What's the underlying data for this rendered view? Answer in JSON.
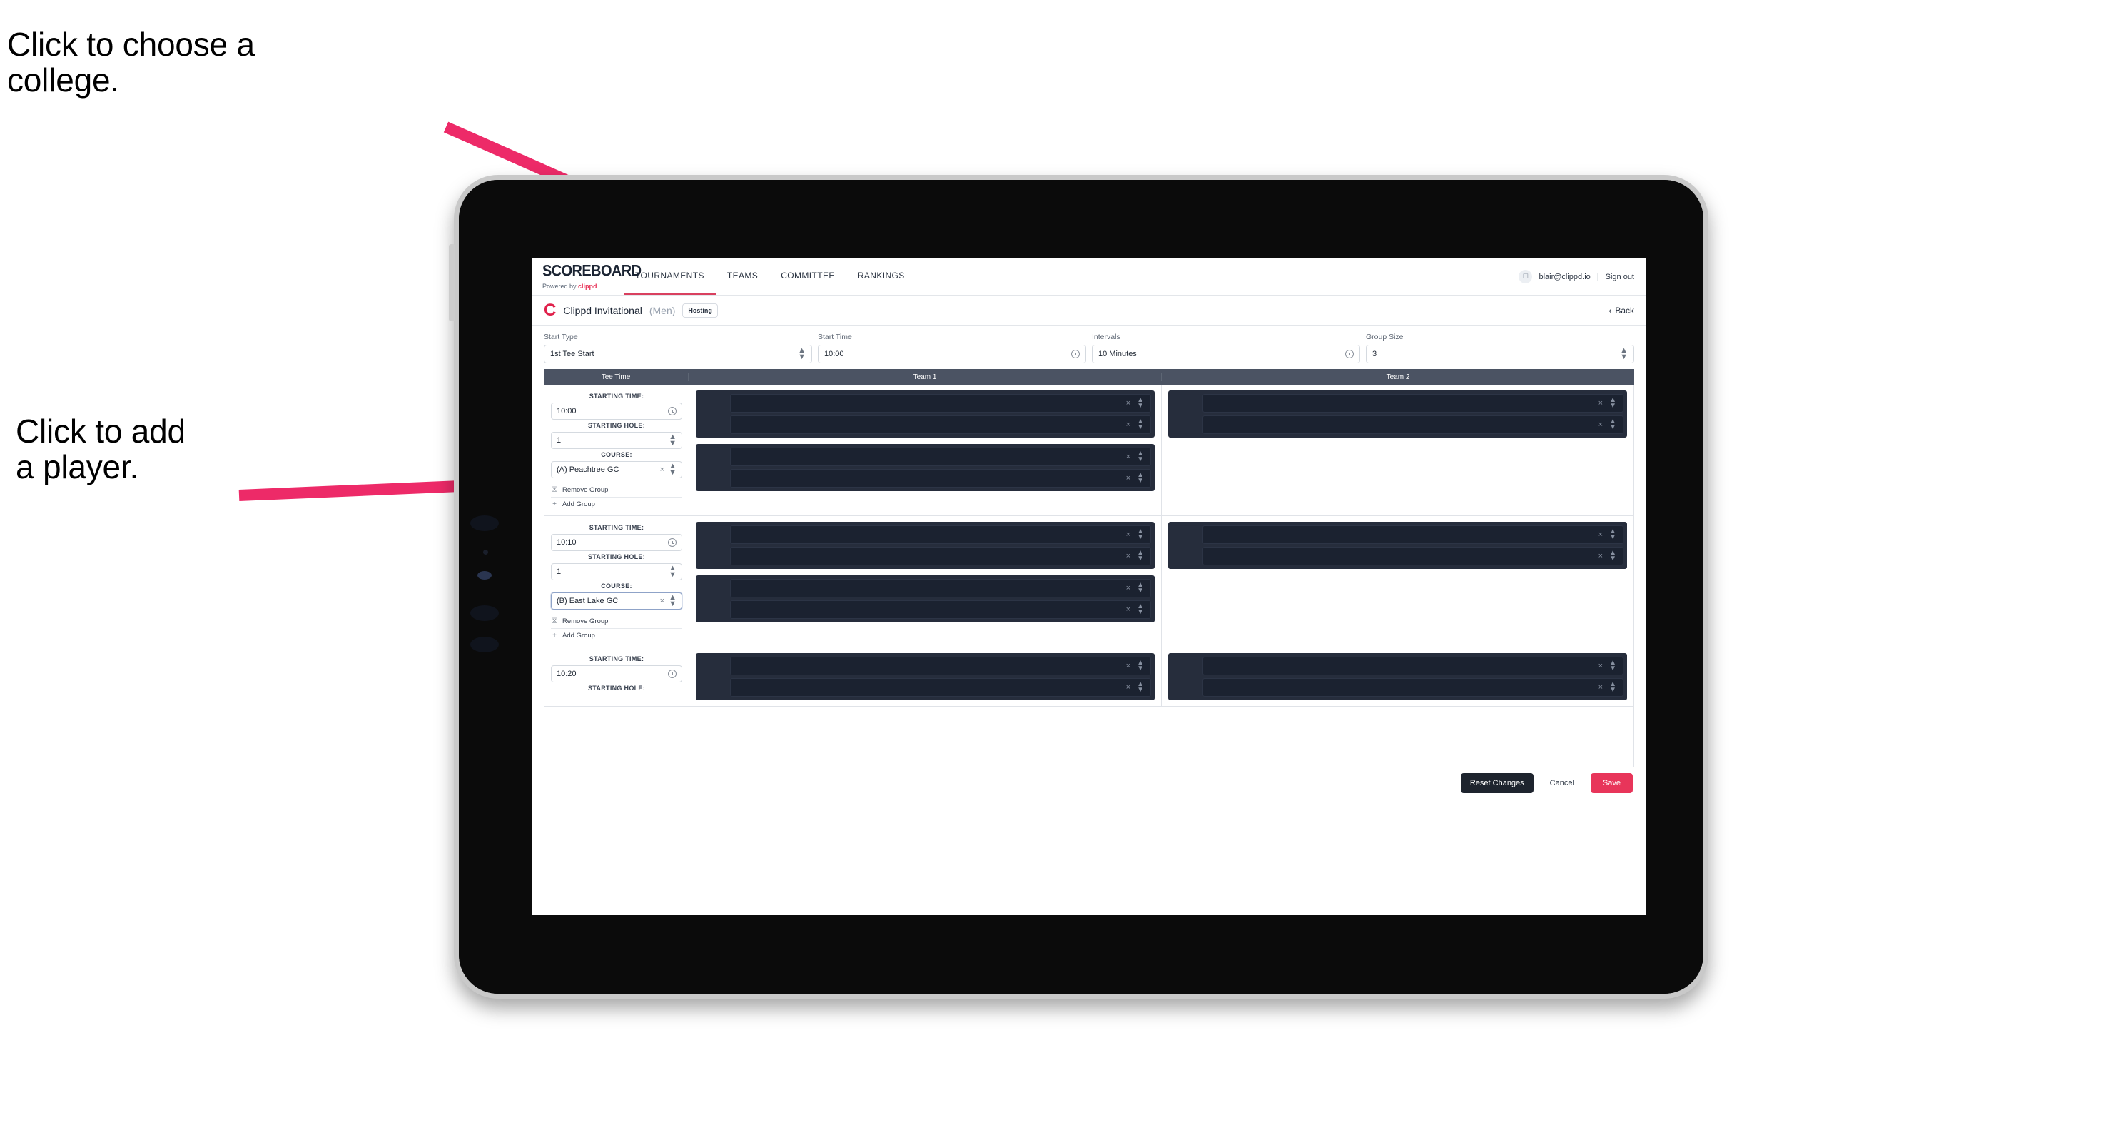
{
  "annotations": [
    {
      "id": "choose-college",
      "text": "Click to choose a\ncollege."
    },
    {
      "id": "add-player",
      "text": "Click to add\na player."
    }
  ],
  "colors": {
    "accent_pink": "#e8355a",
    "tab_underline": "#d9405f",
    "table_header_bg": "#4b5363",
    "player_block_bg": "#262d3c",
    "player_row_bg": "#1b2230",
    "reset_button_bg": "#1e242e",
    "arrow_pink": "#ed2a68"
  },
  "nav": {
    "brand_title": "SCOREBOARD",
    "brand_sub_prefix": "Powered by ",
    "brand_sub_name": "clippd",
    "tabs": [
      {
        "label": "TOURNAMENTS",
        "active": true
      },
      {
        "label": "TEAMS",
        "active": false
      },
      {
        "label": "COMMITTEE",
        "active": false
      },
      {
        "label": "RANKINGS",
        "active": false
      }
    ],
    "avatar_icon": "user-icon",
    "email": "blair@clippd.io",
    "separator": "|",
    "sign_out": "Sign out"
  },
  "title_row": {
    "logo_letter": "C",
    "tournament_name": "Clippd Invitational",
    "gender": "(Men)",
    "status_badge": "Hosting",
    "back_chevron": "‹",
    "back_label": "Back"
  },
  "controls": [
    {
      "label": "Start Type",
      "value": "1st Tee Start",
      "icon": "stepper-icon"
    },
    {
      "label": "Start Time",
      "value": "10:00",
      "icon": "clock-icon"
    },
    {
      "label": "Intervals",
      "value": "10 Minutes",
      "icon": "clock-icon"
    },
    {
      "label": "Group Size",
      "value": "3",
      "icon": "stepper-icon"
    }
  ],
  "table": {
    "headers": [
      "Tee Time",
      "Team 1",
      "Team 2"
    ],
    "field_labels": {
      "starting_time": "STARTING TIME:",
      "starting_hole": "STARTING HOLE:",
      "course": "COURSE:"
    },
    "group_actions": {
      "remove": "Remove Group",
      "remove_icon": "trash-icon",
      "add": "Add Group",
      "add_icon": "plus-icon"
    },
    "groups": [
      {
        "starting_time": "10:00",
        "starting_hole": "1",
        "course": "(A) Peachtree GC",
        "course_focused": false,
        "team1_blocks": [
          2,
          2
        ],
        "team2_blocks": [
          2
        ]
      },
      {
        "starting_time": "10:10",
        "starting_hole": "1",
        "course": "(B) East Lake GC",
        "course_focused": true,
        "team1_blocks": [
          2,
          2
        ],
        "team2_blocks": [
          2
        ]
      },
      {
        "starting_time": "10:20",
        "starting_hole": "",
        "course": "",
        "course_focused": false,
        "team1_blocks": [
          2
        ],
        "team2_blocks": [
          2
        ]
      }
    ],
    "row_icons": {
      "clear": "×",
      "stepper": "stepper-icon"
    }
  },
  "footer": {
    "reset_label": "Reset Changes",
    "cancel_label": "Cancel",
    "save_label": "Save"
  }
}
